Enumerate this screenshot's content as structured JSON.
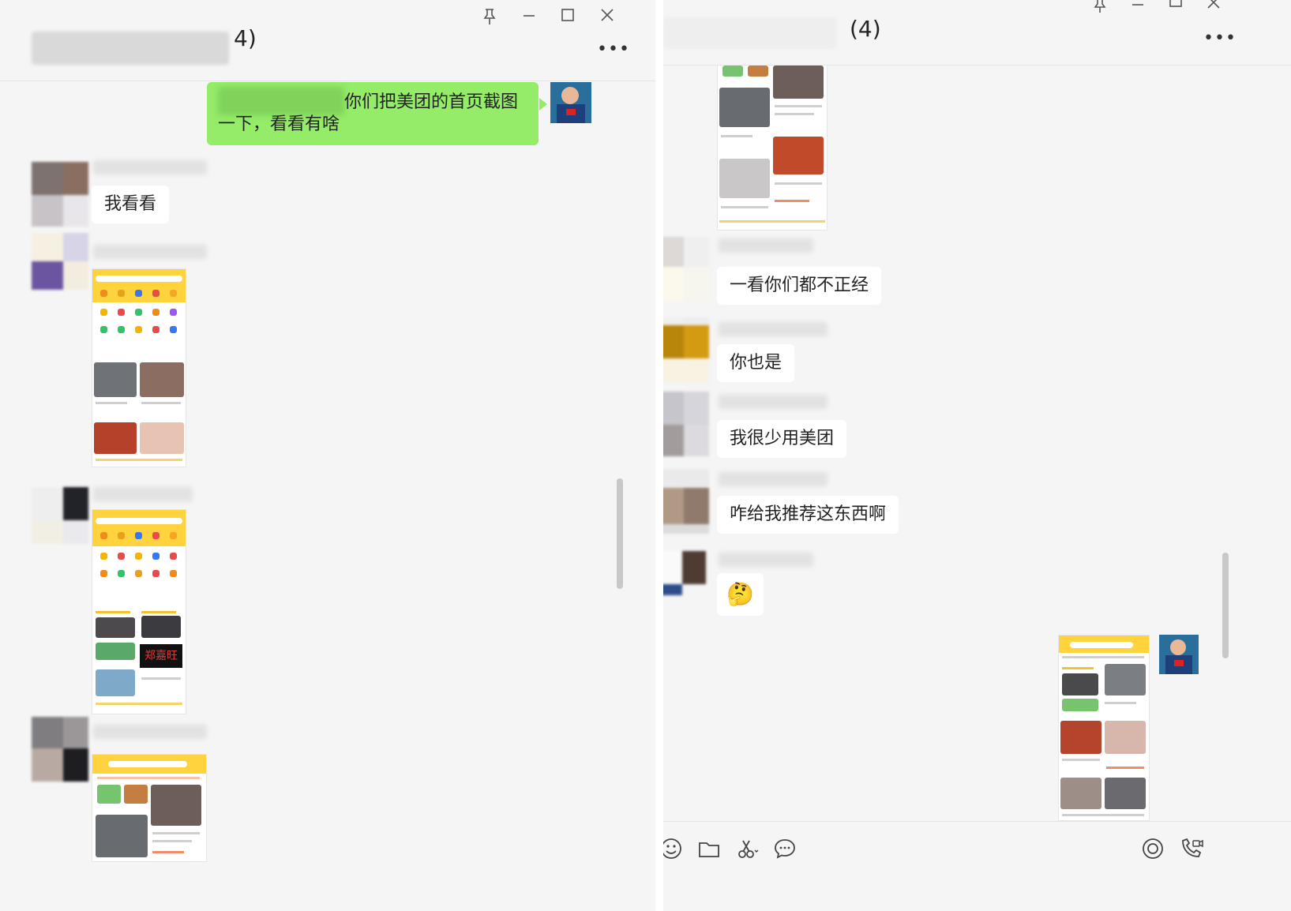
{
  "left_window": {
    "title_suffix": "4)",
    "messages": [
      {
        "side": "me",
        "type": "text",
        "text": "你们把美团的首页截图一下，看看有啥"
      },
      {
        "side": "other",
        "type": "text",
        "text": "我看看"
      },
      {
        "side": "other",
        "type": "image",
        "description_icon": "meituan-homepage-screenshot"
      },
      {
        "side": "other",
        "type": "image",
        "description_icon": "meituan-homepage-screenshot"
      },
      {
        "side": "other",
        "type": "image",
        "description_icon": "meituan-homepage-screenshot"
      }
    ],
    "shot_text": "郑嘉旺"
  },
  "right_window": {
    "title": "(4)",
    "messages": [
      {
        "side": "other",
        "type": "image",
        "description_icon": "meituan-homepage-screenshot"
      },
      {
        "side": "other",
        "type": "text",
        "text": "一看你们都不正经"
      },
      {
        "side": "other",
        "type": "text",
        "text": "你也是"
      },
      {
        "side": "other",
        "type": "text",
        "text": "我很少用美团"
      },
      {
        "side": "other",
        "type": "text",
        "text": "咋给我推荐这东西啊"
      },
      {
        "side": "other",
        "type": "emoji",
        "text": "🤔"
      },
      {
        "side": "me",
        "type": "image",
        "description_icon": "meituan-homepage-screenshot"
      }
    ],
    "toolbar_icons": [
      "emoji-icon",
      "folder-icon",
      "scissors-icon",
      "chat-history-icon",
      "live-icon",
      "call-icon"
    ]
  },
  "colors": {
    "self_bubble": "#95ec69",
    "other_bubble": "#ffffff",
    "window_bg": "#f5f5f5",
    "meituan_yellow": "#ffd33d"
  }
}
